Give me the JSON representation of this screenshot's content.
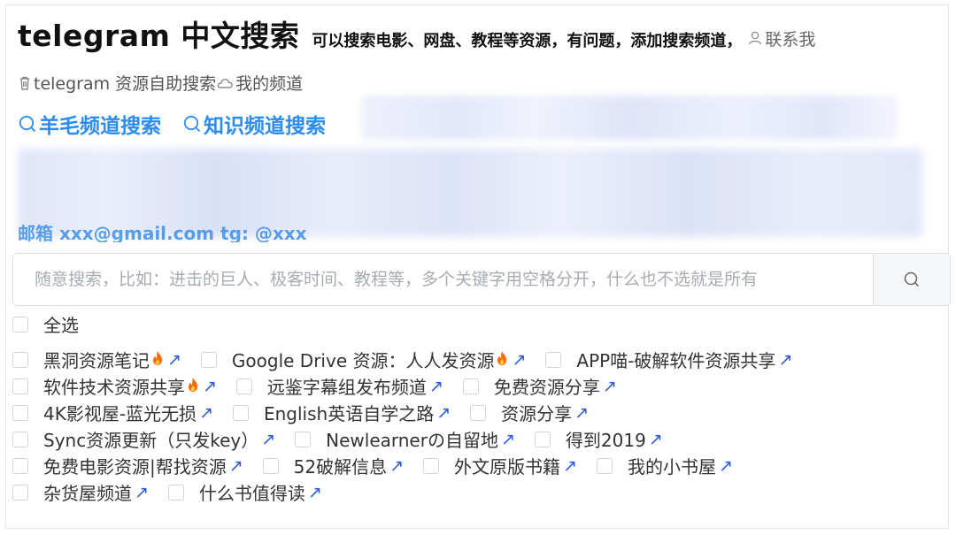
{
  "header": {
    "title": "telegram 中文搜索",
    "subtitle": "可以搜索电影、网盘、教程等资源，有问题，添加搜索频道，",
    "contact_label": "联系我"
  },
  "links": {
    "self_search": "telegram 资源自助搜索",
    "my_channel": "我的频道",
    "wool_search": "羊毛频道搜索",
    "knowledge_search": "知识频道搜索"
  },
  "peek_text": "邮箱   xxx@gmail.com  tg: @xxx",
  "search": {
    "placeholder": "随意搜索，比如：进击的巨人、极客时间、教程等，多个关键字用空格分开，什么也不选就是所有",
    "value": ""
  },
  "select_all_label": "全选",
  "ext_glyph": "↗",
  "channel_rows": [
    [
      {
        "label": "黑洞资源笔记",
        "hot": true
      },
      {
        "label": "Google Drive 资源：人人发资源",
        "hot": true
      },
      {
        "label": "APP喵-破解软件资源共享",
        "hot": false
      }
    ],
    [
      {
        "label": "软件技术资源共享",
        "hot": true
      },
      {
        "label": "远鉴字幕组发布频道",
        "hot": false
      },
      {
        "label": "免费资源分享",
        "hot": false
      }
    ],
    [
      {
        "label": "4K影视屋-蓝光无损",
        "hot": false
      },
      {
        "label": "English英语自学之路",
        "hot": false
      },
      {
        "label": "资源分享",
        "hot": false
      }
    ],
    [
      {
        "label": "Sync资源更新（只发key）",
        "hot": false
      },
      {
        "label": "Newlearnerの自留地",
        "hot": false
      },
      {
        "label": "得到2019",
        "hot": false
      }
    ],
    [
      {
        "label": "免费电影资源|帮找资源",
        "hot": false
      },
      {
        "label": "52破解信息",
        "hot": false
      },
      {
        "label": "外文原版书籍",
        "hot": false
      },
      {
        "label": "我的小书屋",
        "hot": false
      }
    ],
    [
      {
        "label": "杂货屋频道",
        "hot": false
      },
      {
        "label": "什么书值得读",
        "hot": false
      }
    ]
  ],
  "colors": {
    "link_blue": "#2d8cf0",
    "ext_arrow": "#2d5bd9",
    "fire": "#ff6a00"
  }
}
